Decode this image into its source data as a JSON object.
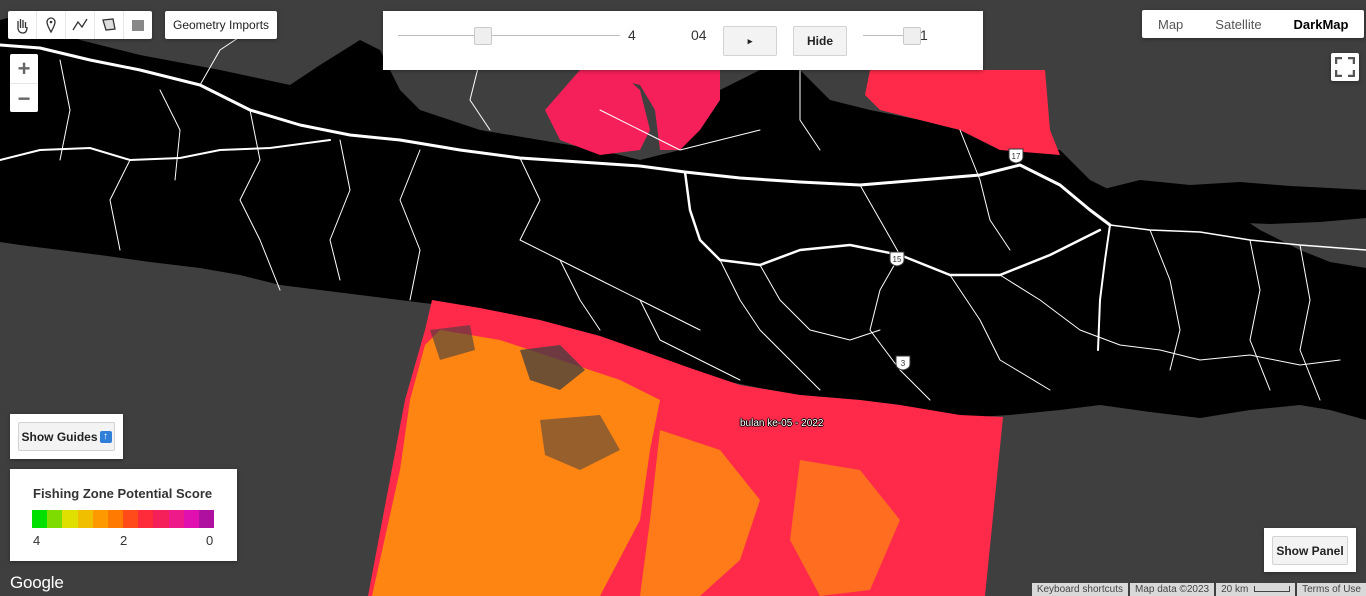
{
  "toolbar": {
    "tools": [
      {
        "icon": "hand-icon"
      },
      {
        "icon": "marker-icon"
      },
      {
        "icon": "polyline-icon"
      },
      {
        "icon": "polygon-icon"
      },
      {
        "icon": "rectangle-icon"
      }
    ],
    "geometry_imports_label": "Geometry Imports"
  },
  "zoom": {
    "in_label": "+",
    "out_label": "−"
  },
  "controls": {
    "month_slider_value": "4",
    "month_display": "04",
    "play_label": "▸",
    "hide_label": "Hide",
    "opacity_value": "1",
    "month_slider_fraction": 0.38,
    "opacity_fraction": 1.0
  },
  "map_types": {
    "options": [
      "Map",
      "Satellite",
      "DarkMap"
    ],
    "active": "DarkMap"
  },
  "guides": {
    "label": "Show Guides",
    "badge": "↑"
  },
  "legend": {
    "title": "Fishing Zone Potential Score",
    "min_label": "4",
    "mid_label": "2",
    "max_label": "0",
    "colors": [
      "#00e000",
      "#7fdc00",
      "#e0e000",
      "#f0c000",
      "#ff9900",
      "#ff7a00",
      "#ff4a1a",
      "#ff2a3a",
      "#f5205a",
      "#ef1a8a",
      "#e010b0",
      "#b010a0"
    ]
  },
  "show_panel_label": "Show Panel",
  "map_label": "bulan ke-05 - 2022",
  "road_shields": [
    "17",
    "15",
    "3"
  ],
  "google_logo": "Google",
  "attribution": {
    "shortcuts": "Keyboard shortcuts",
    "map_data": "Map data ©2023",
    "scale": "20 km",
    "terms": "Terms of Use"
  },
  "colors": {
    "sea": "#3f3f3f",
    "land": "#000000",
    "roads": "#ffffff",
    "score_orange": "#ff8a10",
    "score_red": "#ff2a4a"
  }
}
